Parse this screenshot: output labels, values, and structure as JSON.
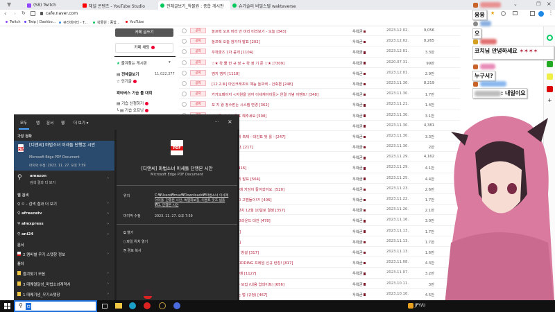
{
  "browser": {
    "tabs": [
      {
        "label": "(58) Twitch",
        "color": "#9146ff"
      },
      {
        "label": "채널 콘텐츠 - YouTube Studio",
        "color": "#ff0000"
      },
      {
        "label": "전체글보기_왁물원 : 종합 게시판",
        "color": "#03c75a",
        "active": true
      },
      {
        "label": "슈가슬러 비밀스텔 waktaverse",
        "color": "#03c75a"
      }
    ],
    "url": "cafe.naver.com",
    "bookmarks": [
      {
        "label": "Twitch",
        "color": "#9146ff"
      },
      {
        "label": "Twip | Dashbo...",
        "color": "#6a3cff"
      },
      {
        "label": "큐리에이터 - T...",
        "color": "#3a8ee6"
      },
      {
        "label": "왁물원 : 종합...",
        "color": "#03c75a"
      },
      {
        "label": "YouTube",
        "color": "#e00"
      }
    ]
  },
  "cafe_sidebar": {
    "write_button": "카페 글쓰기",
    "chat_button": "카페 채팅",
    "favorites": "즐겨찾는 게시판",
    "all_posts": "전체글보기",
    "all_posts_count": "11,022,377",
    "popular": "인기글",
    "section": "왁타버스 기습 톨 대회",
    "items": [
      "기습 신청하기",
      "기습 오프닝"
    ]
  },
  "posts": {
    "badge": "공지",
    "author": "우왁굳",
    "rows": [
      {
        "title": "놀프렉 오프 미리 안 미리 미리보기 - 오늘 [343]",
        "date": "2023.12.02.",
        "views": "9,056"
      },
      {
        "title": "놀프렉 오늘 참가자 발표 [202]",
        "date": "2023.12.02.",
        "views": "8,265"
      },
      {
        "title": "우왁굳즈 1차 공개 [1104]",
        "date": "2023.12.01.",
        "views": "3.3만"
      },
      {
        "title": "☆★ 왁 물 헌 규 정 + 왁 정 기 준 ☆★ [7309]",
        "date": "2020.07.31.",
        "views": "99만"
      },
      {
        "title": "엠지 엠지 [1118]",
        "date": "2023.12.01.",
        "views": "2.9만"
      },
      {
        "title": "[12.2.토] 마인크래프트 예능 놀프렉 - 건축편 [248]",
        "date": "2023.11.30.",
        "views": "8,219"
      },
      {
        "title": "카카오페이지 <자원을 넘어 이세계아이돌> 완결 기념 이벤트! [348]",
        "date": "2023.11.30.",
        "views": "1.7만"
      },
      {
        "title": "포 지 왕 정수받는 시스템 변경 [362]",
        "date": "2023.11.21.",
        "views": "1.4만"
      },
      {
        "title": "이세돌 마지막 투표 해주세요 [508]",
        "date": "2023.11.30.",
        "views": "3.1만"
      },
      {
        "title": "[55]",
        "date": "2023.11.30.",
        "views": "4,381"
      },
      {
        "title": "기습 톨 대회 : 최의 축제 - 대진표 및 룰 - [247]",
        "date": "2023.11.30.",
        "views": "3.3만"
      },
      {
        "title": "탑승 권장 드립니다. [217]",
        "date": "2023.11.30.",
        "views": "2만"
      },
      {
        "title": "[52]",
        "date": "2023.11.29.",
        "views": "4,162"
      },
      {
        "title": "스 기습 톨 대회 [416]",
        "date": "2023.11.29.",
        "views": "4.1만"
      },
      {
        "title": "잔치 100인 엔트리 발표 [564]",
        "date": "2023.11.25.",
        "views": "4.4만"
      },
      {
        "title": "얼리언스 TOP10 에 키당이 들어갔어요. [520]",
        "date": "2023.11.23.",
        "views": "2.6만"
      },
      {
        "title": "이모티콘 이번엔 그 고멤들이!?! [406]",
        "date": "2023.11.22.",
        "views": "1.7만"
      },
      {
        "title": "왁타버스 배그 대잔치 12월 10일로 결정 [357]",
        "date": "2023.11.20.",
        "views": "2.1만"
      },
      {
        "title": "잔밀 100인 배틀그라운드 대잔 [478]",
        "date": "2023.11.16.",
        "views": "3.0만"
      },
      {
        "title": "시스템 도입 [365]",
        "date": "2023.11.13.",
        "views": "1.7만"
      },
      {
        "title": "합예 시스템 [367]",
        "date": "2023.11.13.",
        "views": "1.7만"
      },
      {
        "title": "니메이션 노동센터 창설 [317]",
        "date": "2023.11.13.",
        "views": "1.6만"
      },
      {
        "title": "이돌 x 포토이즘 KIDDING 프레임 신규 런칭! [817]",
        "date": "2023.11.08.",
        "views": "4.3만"
      },
      {
        "title": "NEW 이모티콘 발매 [1127]",
        "date": "2023.11.07.",
        "views": "3.2만"
      },
      {
        "title": "4분기 배너 광고주 모집 (내용 업데이트) [656]",
        "date": "2023.10.11.",
        "views": "3만"
      },
      {
        "title": "드코어 서버 즐기는 법 (규정) [467]",
        "date": "2023.10.10.",
        "views": "4.5만"
      }
    ]
  },
  "search": {
    "tabs": [
      "모두",
      "앱",
      "문서",
      "웹",
      "더 보기 ▾"
    ],
    "best_match_header": "가장 정확",
    "best_match": {
      "title": "[디앤씨] 마법소녀 이세돌 단행본 시안",
      "type": "Microsoft Edge PDF Document",
      "modified": "마지막 수정: 2023. 11. 27. 오후 7:59"
    },
    "amazon": {
      "title": "amazon",
      "sub": "검색 결과 더 보기"
    },
    "web_header": "웹 검색",
    "web_items": [
      "ㅁ - 검색 결과 더 보기",
      "afreecatv",
      "aliexpress",
      "ani24"
    ],
    "docs_header": "문서",
    "docs": [
      "2.멤버별 우기 스탯창 정보"
    ],
    "folders_header": "폴더",
    "folders": [
      "즐겨찾기 모음",
      "3.대퀘열달성_마법소녀계약서",
      "1.대퀘기념_무기스탯창"
    ],
    "preview": {
      "title": "[디앤씨] 마법소녀 이세돌 단행본 시안",
      "type": "Microsoft Edge PDF Document",
      "location_label": "위치",
      "location": "C:₩Users₩mse₩Downloads₩마법소녀 이세계아이돌_단행본 시안, 특별화보집, 이벤트 굿즈 샘플₩1. 단행본 시안",
      "modified_label": "마지막 수정",
      "modified": "2023. 11. 27. 오후 7:59",
      "actions": [
        "열기",
        "파일 위치 열기",
        "경로 복사"
      ]
    },
    "query": "ㅁ",
    "pdf_label": "PDF"
  },
  "chat": {
    "messages": [
      "응응",
      "오",
      "코치님 안녕하세요",
      "누구서?",
      ": 내일이요"
    ]
  },
  "taskbar": {
    "tray_text": "JPY/U"
  }
}
